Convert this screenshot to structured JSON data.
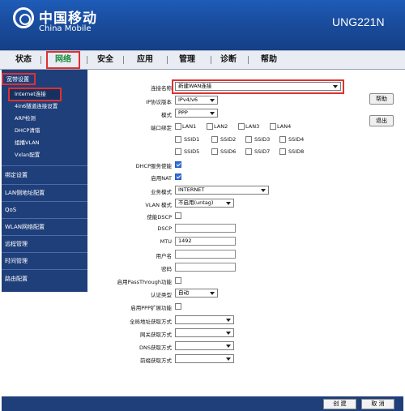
{
  "header": {
    "brand_cn": "中国移动",
    "brand_en": "China Mobile",
    "model": "UNG221N"
  },
  "nav": {
    "items": [
      "状态",
      "网络",
      "安全",
      "应用",
      "管理",
      "诊断",
      "帮助"
    ],
    "active": "网络"
  },
  "sidebar": {
    "sections": [
      "宽带设置",
      "绑定设置",
      "LAN侧地址配置",
      "QoS",
      "WLAN网络配置",
      "远程管理",
      "时间管理",
      "路由配置"
    ],
    "sub_items": [
      "Internet连接",
      "4in6隧道连接设置",
      "ARP检测",
      "DHCP清错",
      "组播VLAN",
      "Vxlan配置"
    ],
    "active_sub": "Internet连接"
  },
  "form": {
    "conn_name": {
      "label": "连接名称",
      "value": "新建WAN连接"
    },
    "ip_version": {
      "label": "IP协议版本",
      "value": "IPv4/v6"
    },
    "mode": {
      "label": "模式",
      "value": "PPP"
    },
    "port_bind": {
      "label": "端口绑定",
      "lan": [
        "LAN1",
        "LAN2",
        "LAN3",
        "LAN4"
      ],
      "ssid_row1": [
        "SSID1",
        "SSID2",
        "SSID3",
        "SSID4"
      ],
      "ssid_row2": [
        "SSID5",
        "SSID6",
        "SSID7",
        "SSID8"
      ]
    },
    "dhcp_enable": {
      "label": "DHCP服务使能",
      "checked": true
    },
    "nat_enable": {
      "label": "启用NAT",
      "checked": true
    },
    "service_mode": {
      "label": "业务模式",
      "value": "INTERNET"
    },
    "vlan_mode": {
      "label": "VLAN 模式",
      "value": "不启用(untag)"
    },
    "dscp_enable": {
      "label": "使能DSCP",
      "checked": false
    },
    "dscp": {
      "label": "DSCP",
      "value": ""
    },
    "mtu": {
      "label": "MTU",
      "value": "1492"
    },
    "username": {
      "label": "用户名",
      "value": ""
    },
    "password": {
      "label": "密码",
      "value": ""
    },
    "passthrough": {
      "label": "启用PassThrough功能",
      "checked": false
    },
    "auth_type": {
      "label": "认证类型",
      "value": "自动"
    },
    "ppp_ext": {
      "label": "启用PPP扩展功能",
      "checked": false
    },
    "global_addr": {
      "label": "全局地址获取方式",
      "value": ""
    },
    "gateway": {
      "label": "网关获取方式",
      "value": ""
    },
    "dns": {
      "label": "DNS获取方式",
      "value": ""
    },
    "prefix": {
      "label": "前缀获取方式",
      "value": ""
    }
  },
  "side_buttons": {
    "help": "帮助",
    "logout": "退出"
  },
  "footer": {
    "create": "创 建",
    "cancel": "取 消"
  },
  "colors": {
    "header": "#1a4ea0",
    "sidebar": "#1f3f7a",
    "highlight": "#e03030",
    "active_nav": "#1a8a3a"
  }
}
